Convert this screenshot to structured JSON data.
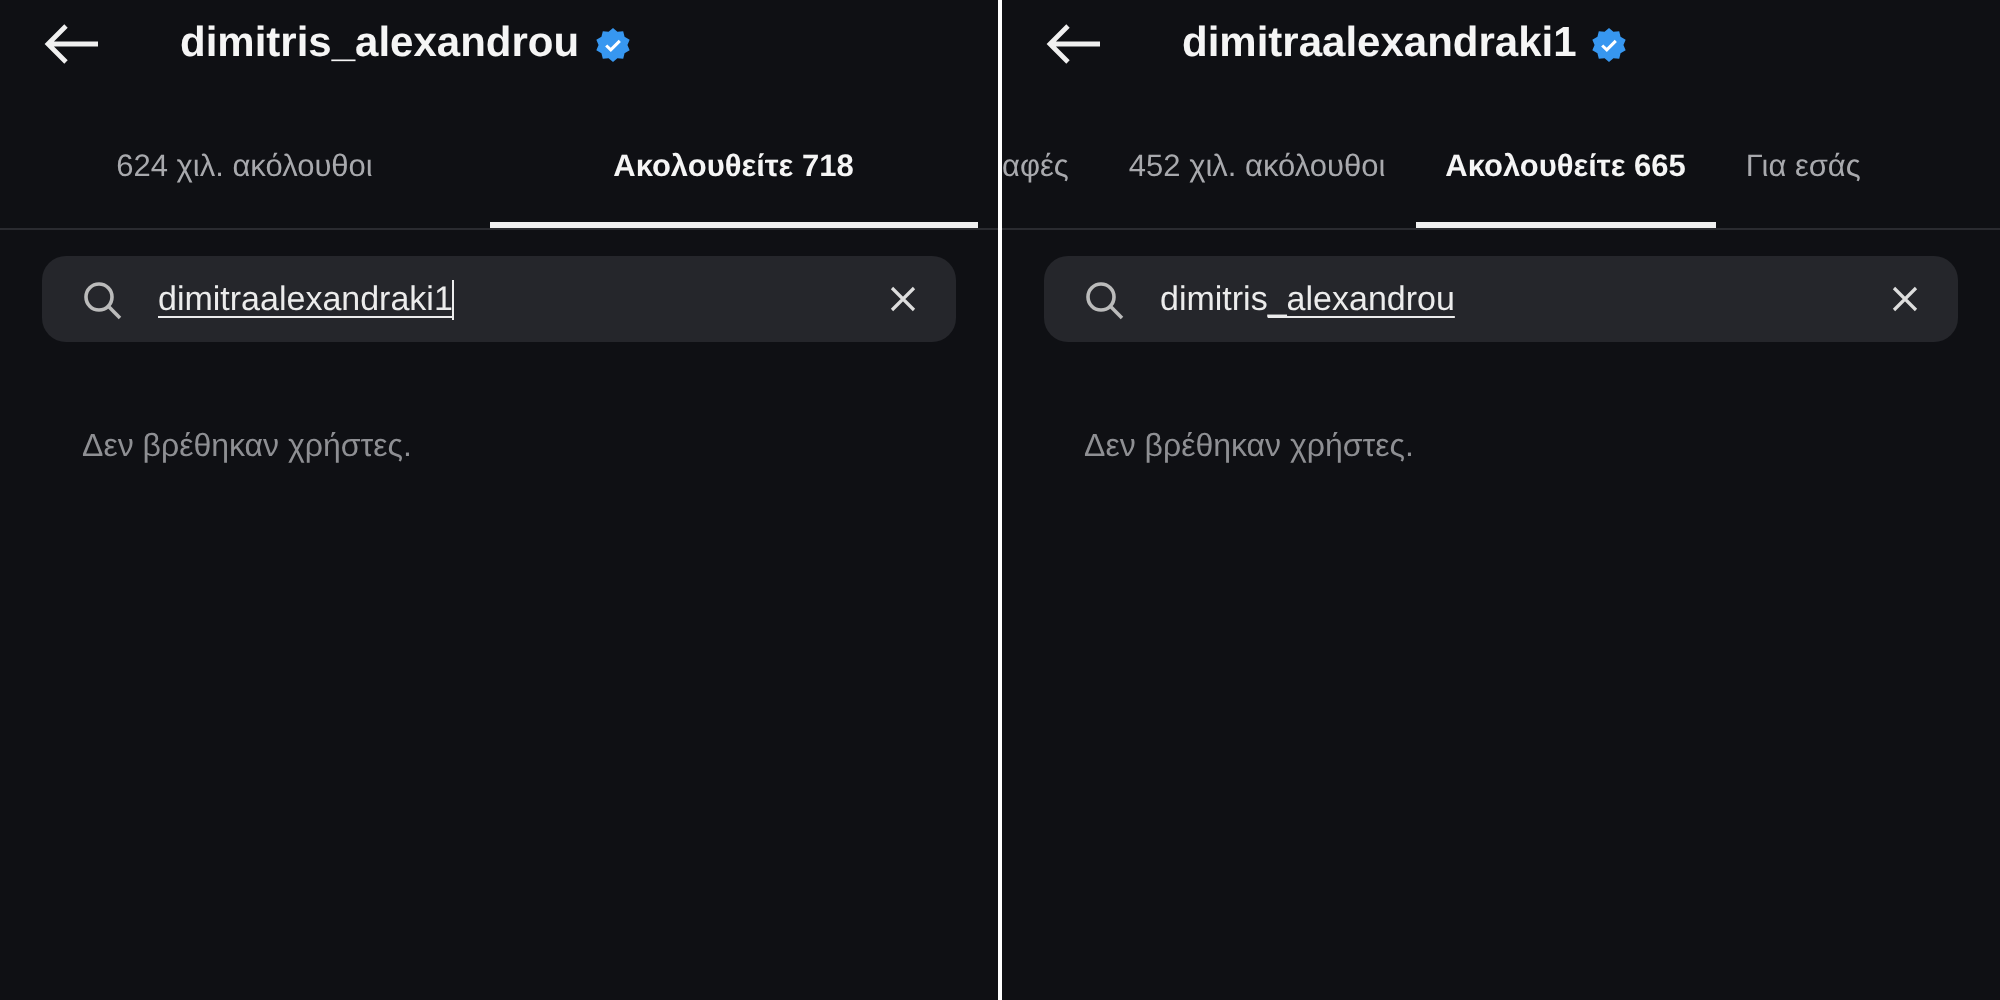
{
  "panels": [
    {
      "title": "dimitris_alexandrou",
      "verified": true,
      "tabs": [
        {
          "label": "624 χιλ. ακόλουθοι",
          "selected": false
        },
        {
          "label": "Ακολουθείτε 718",
          "selected": true
        }
      ],
      "search": {
        "value": [
          {
            "text": "dimitraalexandraki1",
            "underlined": true
          }
        ],
        "cursor": true
      },
      "message": "Δεν βρέθηκαν χρήστες."
    },
    {
      "title": "dimitraalexandraki1",
      "verified": true,
      "tabs": [
        {
          "label": "αφές",
          "selected": false
        },
        {
          "label": "452 χιλ. ακόλουθοι",
          "selected": false
        },
        {
          "label": "Ακολουθείτε 665",
          "selected": true
        },
        {
          "label": "Για εσάς",
          "selected": false
        }
      ],
      "search": {
        "value": [
          {
            "text": "dimitris",
            "underlined": false
          },
          {
            "text": "_alexandrou",
            "underlined": true
          }
        ],
        "cursor": false
      },
      "message": "Δεν βρέθηκαν χρήστες."
    }
  ]
}
